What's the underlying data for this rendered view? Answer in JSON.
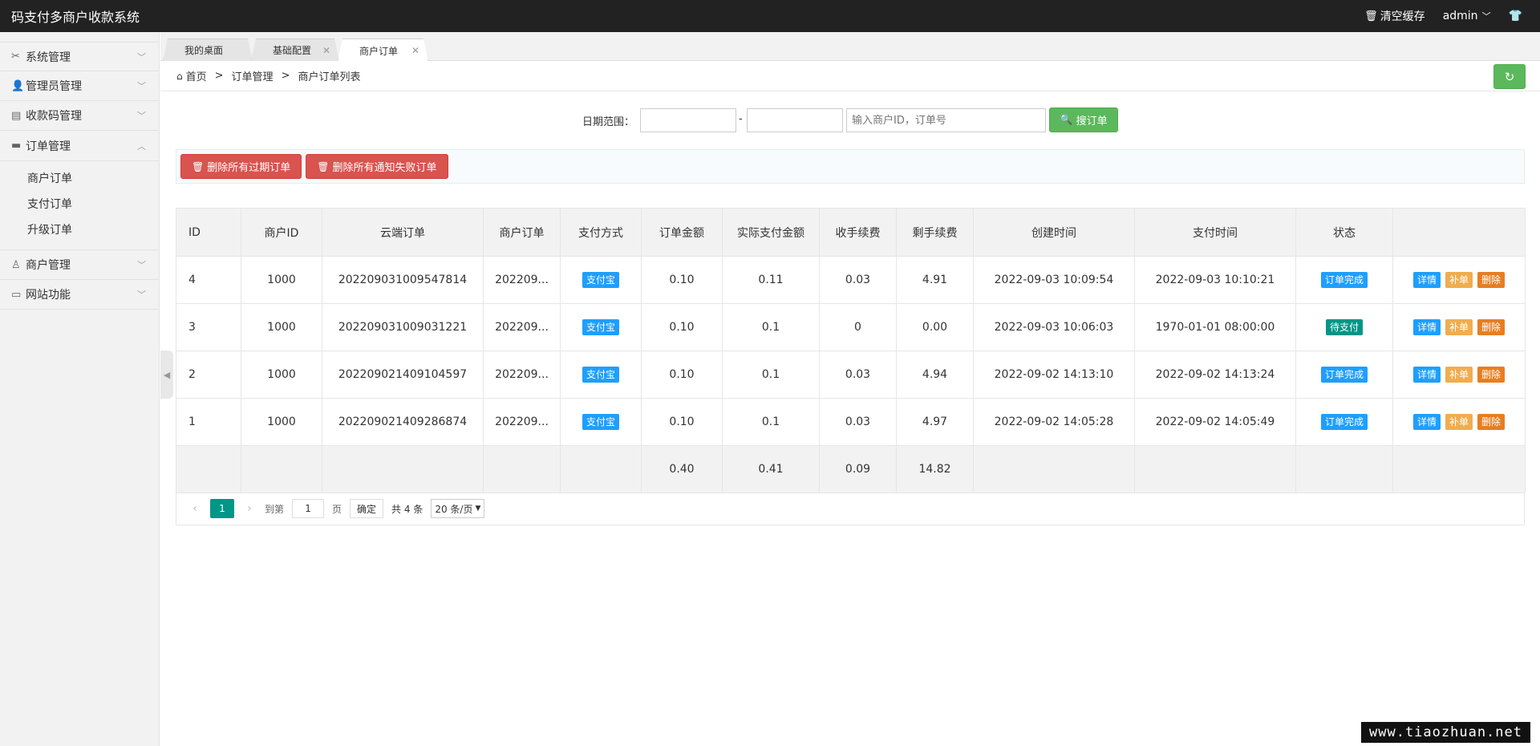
{
  "header": {
    "title": "码支付多商户收款系统",
    "clear_cache": "清空缓存",
    "user": "admin"
  },
  "sidebar": {
    "items": [
      {
        "label": "系统管理"
      },
      {
        "label": "管理员管理"
      },
      {
        "label": "收款码管理"
      },
      {
        "label": "订单管理",
        "children": [
          "商户订单",
          "支付订单",
          "升级订单"
        ]
      },
      {
        "label": "商户管理"
      },
      {
        "label": "网站功能"
      }
    ]
  },
  "tabs": [
    {
      "label": "我的桌面"
    },
    {
      "label": "基础配置"
    },
    {
      "label": "商户订单"
    }
  ],
  "breadcrumb": [
    "首页",
    "订单管理",
    "商户订单列表"
  ],
  "search": {
    "date_label": "日期范围：",
    "date_sep": "-",
    "keyword_placeholder": "输入商户ID，订单号",
    "button": "搜订单"
  },
  "toolbar": {
    "delete_expired": "删除所有过期订单",
    "delete_notify_failed": "删除所有通知失败订单"
  },
  "table": {
    "columns": [
      "ID",
      "商户ID",
      "云端订单",
      "商户订单",
      "支付方式",
      "订单金额",
      "实际支付金额",
      "收手续费",
      "剩手续费",
      "创建时间",
      "支付时间",
      "状态",
      ""
    ],
    "rows": [
      {
        "id": "4",
        "merchant_id": "1000",
        "cloud_order": "202209031009547814",
        "merchant_order": "202209...",
        "pay_method": "支付宝",
        "amount": "0.10",
        "paid": "0.11",
        "fee": "0.03",
        "remain_fee": "4.91",
        "created": "2022-09-03 10:09:54",
        "paid_time": "2022-09-03 10:10:21",
        "status": "订单完成",
        "status_color": "#1e9fff"
      },
      {
        "id": "3",
        "merchant_id": "1000",
        "cloud_order": "202209031009031221",
        "merchant_order": "202209...",
        "pay_method": "支付宝",
        "amount": "0.10",
        "paid": "0.1",
        "fee": "0",
        "remain_fee": "0.00",
        "created": "2022-09-03 10:06:03",
        "paid_time": "1970-01-01 08:00:00",
        "status": "待支付",
        "status_color": "#009688"
      },
      {
        "id": "2",
        "merchant_id": "1000",
        "cloud_order": "202209021409104597",
        "merchant_order": "202209...",
        "pay_method": "支付宝",
        "amount": "0.10",
        "paid": "0.1",
        "fee": "0.03",
        "remain_fee": "4.94",
        "created": "2022-09-02 14:13:10",
        "paid_time": "2022-09-02 14:13:24",
        "status": "订单完成",
        "status_color": "#1e9fff"
      },
      {
        "id": "1",
        "merchant_id": "1000",
        "cloud_order": "202209021409286874",
        "merchant_order": "202209...",
        "pay_method": "支付宝",
        "amount": "0.10",
        "paid": "0.1",
        "fee": "0.03",
        "remain_fee": "4.97",
        "created": "2022-09-02 14:05:28",
        "paid_time": "2022-09-02 14:05:49",
        "status": "订单完成",
        "status_color": "#1e9fff"
      }
    ],
    "actions": [
      "详情",
      "补单",
      "删除"
    ],
    "totals": {
      "amount": "0.40",
      "paid": "0.41",
      "fee": "0.09",
      "remain_fee": "14.82"
    }
  },
  "pager": {
    "current": "1",
    "goto_label": "到第",
    "goto_value": "1",
    "page_label": "页",
    "confirm": "确定",
    "total": "共 4 条",
    "page_size": "20 条/页"
  },
  "watermark": "www.tiaozhuan.net",
  "icons": {
    "clear_cache": "trash-icon",
    "user_menu": "chevron-down-icon",
    "skin": "tshirt-icon",
    "home": "home-icon",
    "refresh": "refresh-icon",
    "search": "search-icon",
    "delete": "trash-icon"
  },
  "colors": {
    "topbar": "#222222",
    "green": "#5cb85c",
    "red": "#d9534f",
    "blue": "#1e9fff",
    "teal": "#009688",
    "yellow": "#f0ad4e",
    "orange": "#e67e22"
  }
}
